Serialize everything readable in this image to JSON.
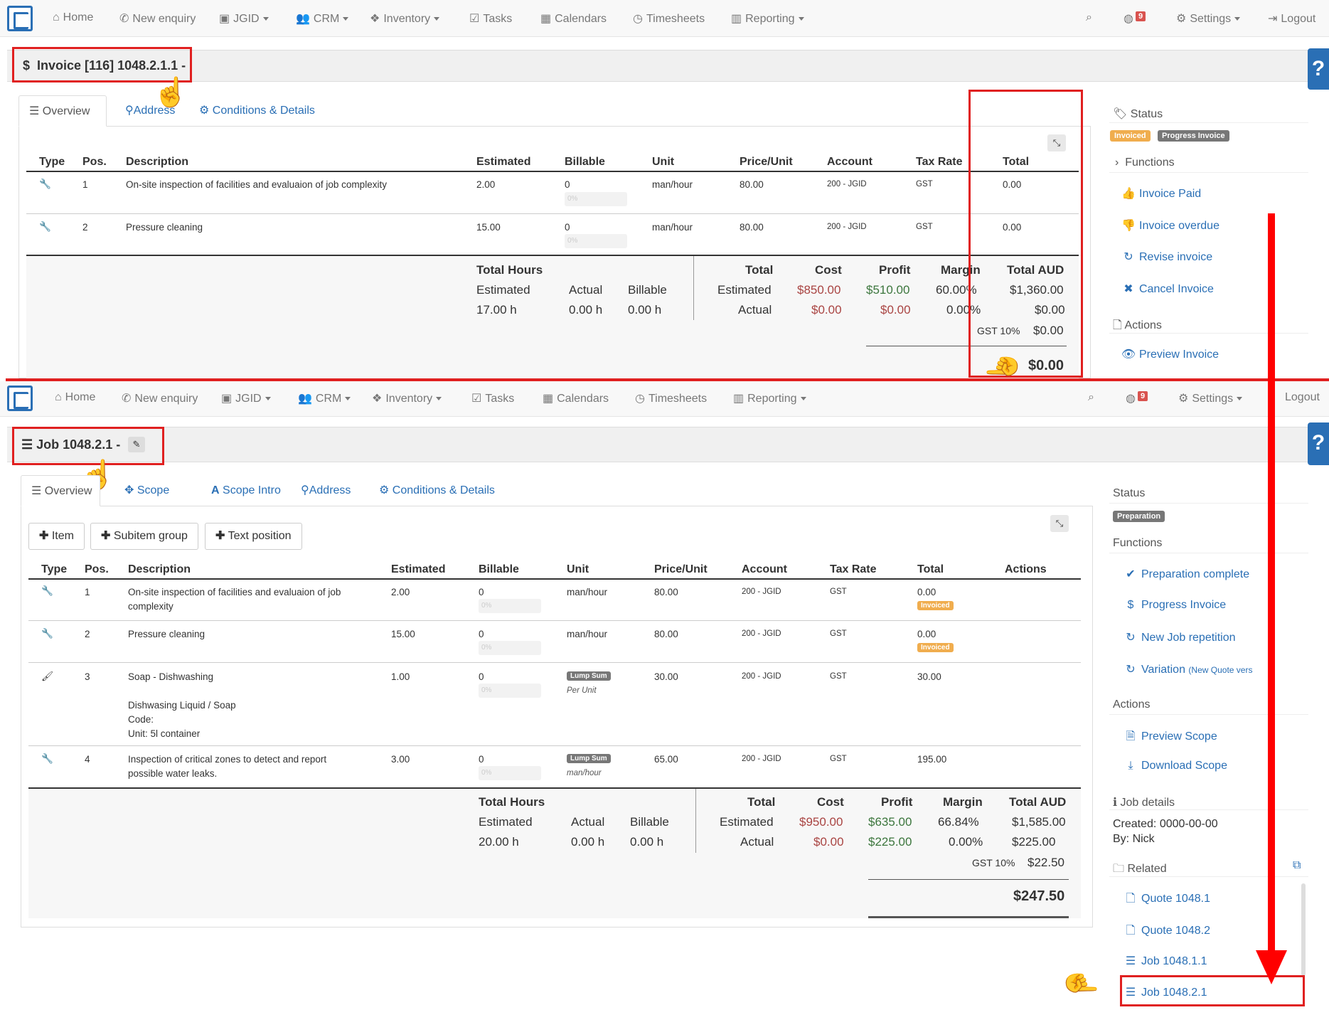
{
  "nav": {
    "home": "Home",
    "new_enquiry": "New enquiry",
    "jgid": "JGID",
    "crm": "CRM",
    "inventory": "Inventory",
    "tasks": "Tasks",
    "calendars": "Calendars",
    "timesheets": "Timesheets",
    "reporting": "Reporting",
    "notif_count": "9",
    "settings": "Settings",
    "logout": "Logout"
  },
  "help": "?",
  "invoice": {
    "title": "Invoice [116] 1048.2.1.1 -",
    "tabs": [
      "Overview",
      "Address",
      "Conditions & Details"
    ],
    "columns": [
      "Type",
      "Pos.",
      "Description",
      "Estimated",
      "Billable",
      "Unit",
      "Price/Unit",
      "Account",
      "Tax Rate",
      "Total"
    ],
    "rows": [
      {
        "pos": "1",
        "description": "On-site inspection of facilities and evaluaion of job complexity",
        "estimated": "2.00",
        "billable": "0",
        "progress": "0%",
        "unit": "man/hour",
        "price": "80.00",
        "account": "200 - JGID",
        "tax": "GST",
        "total": "0.00"
      },
      {
        "pos": "2",
        "description": "Pressure cleaning",
        "estimated": "15.00",
        "billable": "0",
        "progress": "0%",
        "unit": "man/hour",
        "price": "80.00",
        "account": "200 - JGID",
        "tax": "GST",
        "total": "0.00"
      }
    ],
    "summary": {
      "total_hours": "Total Hours",
      "estimated_label": "Estimated",
      "actual_label": "Actual",
      "billable_label": "Billable",
      "est_hours": "17.00 h",
      "act_hours": "0.00 h",
      "bill_hours": "0.00 h",
      "total_label": "Total",
      "cost_label": "Cost",
      "profit_label": "Profit",
      "margin_label": "Margin",
      "total_aud_label": "Total AUD",
      "est_row": "Estimated",
      "act_row": "Actual",
      "est_cost": "$850.00",
      "est_profit": "$510.00",
      "est_margin": "60.00%",
      "est_total": "$1,360.00",
      "act_cost": "$0.00",
      "act_profit": "$0.00",
      "act_margin": "0.00%",
      "act_total": "$0.00",
      "gst_label": "GST 10%",
      "gst_value": "$0.00",
      "grand_total": "$0.00"
    },
    "sidebar": {
      "status_label": "Status",
      "badge_invoiced": "Invoiced",
      "badge_progress": "Progress Invoice",
      "functions_label": "Functions",
      "functions": [
        "Invoice Paid",
        "Invoice overdue",
        "Revise invoice",
        "Cancel Invoice"
      ],
      "actions_label": "Actions",
      "actions": [
        "Preview Invoice"
      ]
    }
  },
  "job": {
    "title": "Job 1048.2.1 -",
    "tabs": [
      "Overview",
      "Scope",
      "Scope Intro",
      "Address",
      "Conditions & Details"
    ],
    "buttons": [
      "Item",
      "Subitem group",
      "Text position"
    ],
    "columns": [
      "Type",
      "Pos.",
      "Description",
      "Estimated",
      "Billable",
      "Unit",
      "Price/Unit",
      "Account",
      "Tax Rate",
      "Total",
      "Actions"
    ],
    "rows": [
      {
        "pos": "1",
        "desc1": "On-site inspection of facilities and evaluaion of job",
        "desc2": "complexity",
        "estimated": "2.00",
        "billable": "0",
        "progress": "0%",
        "unit": "man/hour",
        "price": "80.00",
        "account": "200 - JGID",
        "tax": "GST",
        "total": "0.00",
        "badge": "Invoiced"
      },
      {
        "pos": "2",
        "desc1": "Pressure cleaning",
        "estimated": "15.00",
        "billable": "0",
        "progress": "0%",
        "unit": "man/hour",
        "price": "80.00",
        "account": "200 - JGID",
        "tax": "GST",
        "total": "0.00",
        "badge": "Invoiced"
      },
      {
        "pos": "3",
        "desc1": "Soap - Dishwashing",
        "desc_detail1": "Dishwasing Liquid / Soap",
        "desc_detail2": "Code:",
        "desc_detail3": "Unit: 5l container",
        "estimated": "1.00",
        "billable": "0",
        "progress": "0%",
        "unit_badge": "Lump Sum",
        "unit_sub": "Per Unit",
        "price": "30.00",
        "account": "200 - JGID",
        "tax": "GST",
        "total": "30.00"
      },
      {
        "pos": "4",
        "desc1": "Inspection of critical zones to detect and report",
        "desc2": "possible water leaks.",
        "estimated": "3.00",
        "billable": "0",
        "progress": "0%",
        "unit_badge": "Lump Sum",
        "unit_sub": "man/hour",
        "price": "65.00",
        "account": "200 - JGID",
        "tax": "GST",
        "total": "195.00"
      }
    ],
    "summary": {
      "total_hours": "Total Hours",
      "estimated_label": "Estimated",
      "actual_label": "Actual",
      "billable_label": "Billable",
      "est_hours": "20.00 h",
      "act_hours": "0.00 h",
      "bill_hours": "0.00 h",
      "total_label": "Total",
      "cost_label": "Cost",
      "profit_label": "Profit",
      "margin_label": "Margin",
      "total_aud_label": "Total AUD",
      "est_row": "Estimated",
      "act_row": "Actual",
      "est_cost": "$950.00",
      "est_profit": "$635.00",
      "est_margin": "66.84%",
      "est_total": "$1,585.00",
      "act_cost": "$0.00",
      "act_profit": "$225.00",
      "act_margin": "0.00%",
      "act_total": "$225.00",
      "gst_label": "GST 10%",
      "gst_value": "$22.50",
      "grand_total": "$247.50"
    },
    "sidebar": {
      "status_label": "Status",
      "badge_preparation": "Preparation",
      "functions_label": "Functions",
      "functions": [
        "Preparation complete",
        "Progress Invoice",
        "New Job repetition",
        "Variation"
      ],
      "variation_sub": "(New Quote vers",
      "actions_label": "Actions",
      "actions": [
        "Preview Scope",
        "Download Scope"
      ],
      "details_label": "Job details",
      "created": "Created: 0000-00-00",
      "by": "By: Nick",
      "related_label": "Related",
      "related": [
        "Quote 1048.1",
        "Quote 1048.2",
        "Job 1048.1.1",
        "Job 1048.2.1"
      ]
    }
  },
  "colors": {
    "accent": "#2a6fb5",
    "highlight": "#e02020",
    "invoiced": "#f0ad4e",
    "cost": "#a94442",
    "profit": "#3c763d"
  }
}
